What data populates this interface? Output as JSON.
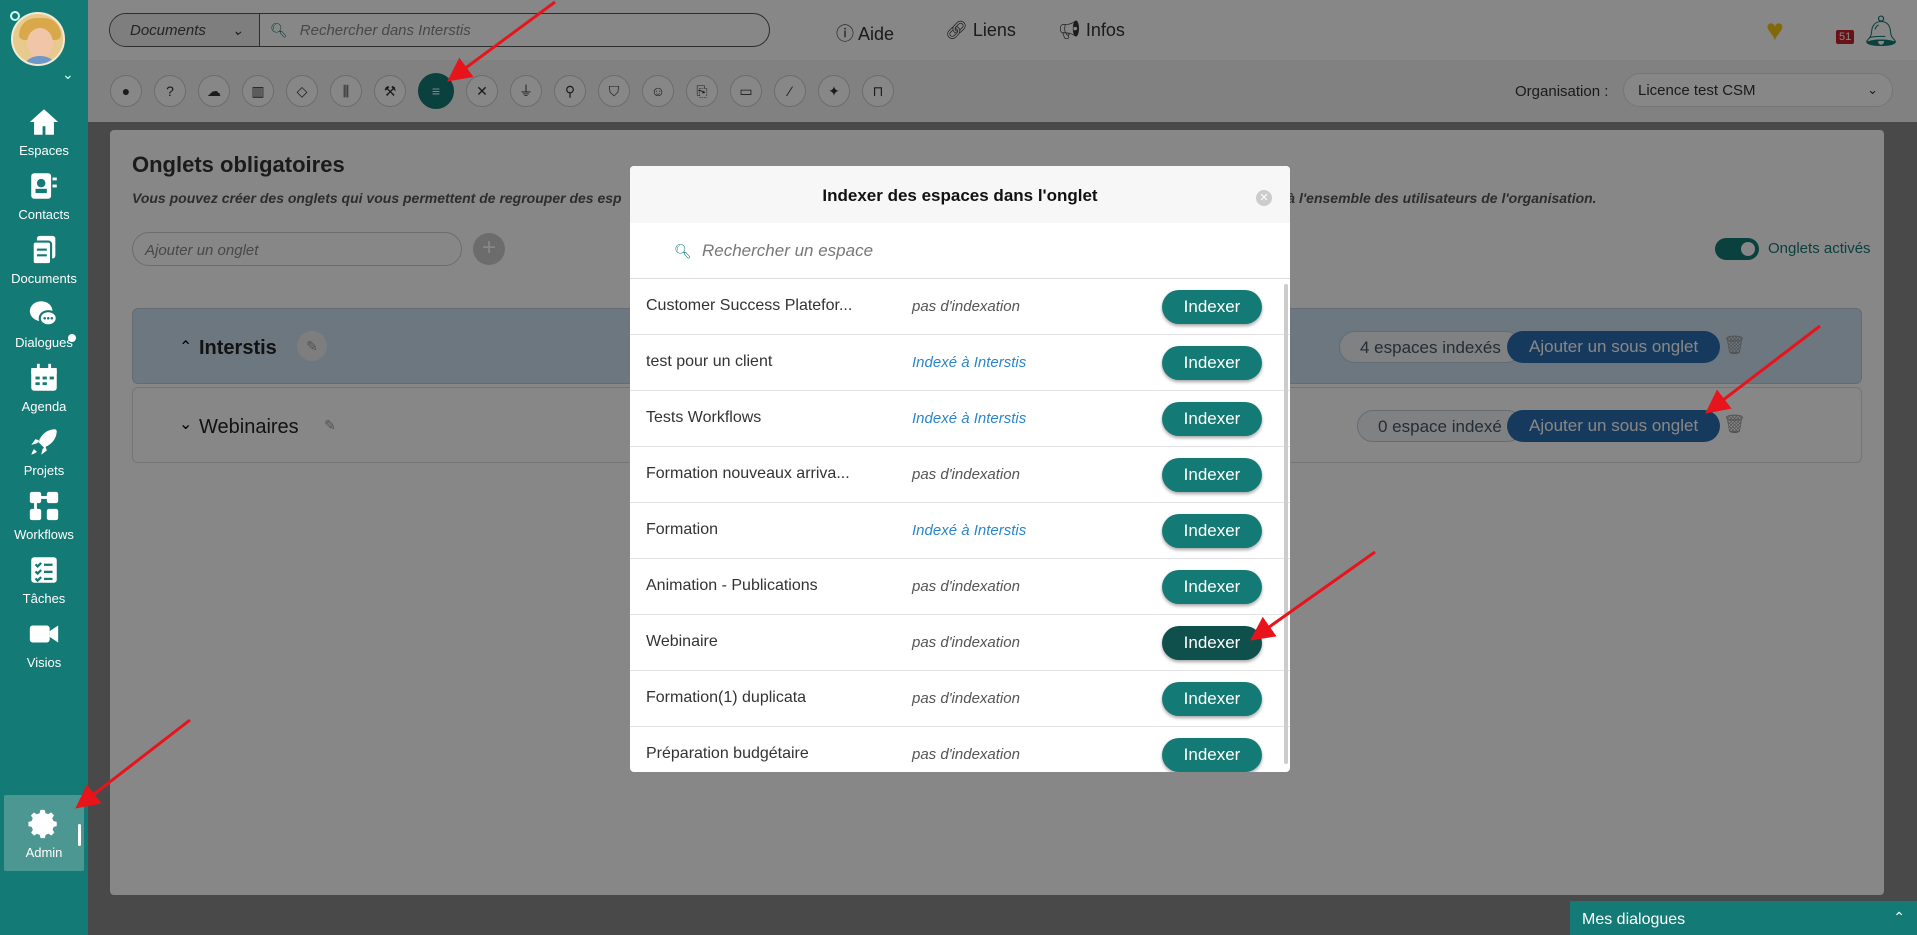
{
  "sidebar": {
    "items": [
      {
        "label": "Espaces",
        "icon": "home-icon"
      },
      {
        "label": "Contacts",
        "icon": "contact-card-icon"
      },
      {
        "label": "Documents",
        "icon": "documents-icon"
      },
      {
        "label": "Dialogues",
        "icon": "chat-bubbles-icon"
      },
      {
        "label": "Agenda",
        "icon": "calendar-icon"
      },
      {
        "label": "Projets",
        "icon": "rocket-icon"
      },
      {
        "label": "Workflows",
        "icon": "workflow-icon"
      },
      {
        "label": "Tâches",
        "icon": "checklist-icon"
      },
      {
        "label": "Visios",
        "icon": "video-camera-icon"
      },
      {
        "label": "Admin",
        "icon": "gear-icon"
      }
    ],
    "active": "Admin"
  },
  "topbar": {
    "scope_label": "Documents",
    "search_placeholder": "Rechercher dans Interstis",
    "links": [
      "Aide",
      "Liens",
      "Infos"
    ],
    "notif_count": "51"
  },
  "toolbar": {
    "icons": [
      "user-icon",
      "help-icon",
      "cloud-icon",
      "chart-icon",
      "tag-icon",
      "sliders-icon",
      "hammer-icon",
      "list-icon",
      "tools-icon",
      "plug-icon",
      "wrench-icon",
      "shield-icon",
      "smiley-icon",
      "document-search-icon",
      "id-card-icon",
      "brush-icon",
      "magic-wand-icon",
      "lock-icon"
    ],
    "active_index": 7,
    "org_label": "Organisation :",
    "org_value": "Licence test CSM"
  },
  "main": {
    "title": "Onglets obligatoires",
    "description_left": "Vous pouvez créer des onglets qui vous permettent de regrouper des esp",
    "description_right": "ont à l'ensemble des utilisateurs de l'organisation.",
    "add_placeholder": "Ajouter un onglet",
    "toggle_label": "Onglets activés",
    "tabs": [
      {
        "name": "Interstis",
        "count": "4 espaces indexés",
        "add_sub": "Ajouter un sous onglet"
      },
      {
        "name": "Webinaires",
        "count": "0 espace indexé",
        "add_sub": "Ajouter un sous onglet"
      }
    ]
  },
  "modal": {
    "title": "Indexer des espaces dans l'onglet",
    "search_placeholder": "Rechercher un espace",
    "button_label": "Indexer",
    "rows": [
      {
        "name": "Customer Success Platefor...",
        "status": "pas d'indexation",
        "indexed": false
      },
      {
        "name": "test pour un client",
        "status": "Indexé à Interstis",
        "indexed": true
      },
      {
        "name": "Tests Workflows",
        "status": "Indexé à Interstis",
        "indexed": true
      },
      {
        "name": "Formation nouveaux arriva...",
        "status": "pas d'indexation",
        "indexed": false
      },
      {
        "name": "Formation",
        "status": "Indexé à Interstis",
        "indexed": true
      },
      {
        "name": "Animation - Publications",
        "status": "pas d'indexation",
        "indexed": false
      },
      {
        "name": "Webinaire",
        "status": "pas d'indexation",
        "indexed": false,
        "hover": true
      },
      {
        "name": "Formation(1) duplicata",
        "status": "pas d'indexation",
        "indexed": false
      },
      {
        "name": "Préparation budgétaire",
        "status": "pas d'indexation",
        "indexed": false
      }
    ]
  },
  "chat": {
    "label": "Mes dialogues"
  },
  "colors": {
    "primary": "#137a75",
    "blue": "#2b6fb0",
    "arrow": "#e8141b"
  }
}
